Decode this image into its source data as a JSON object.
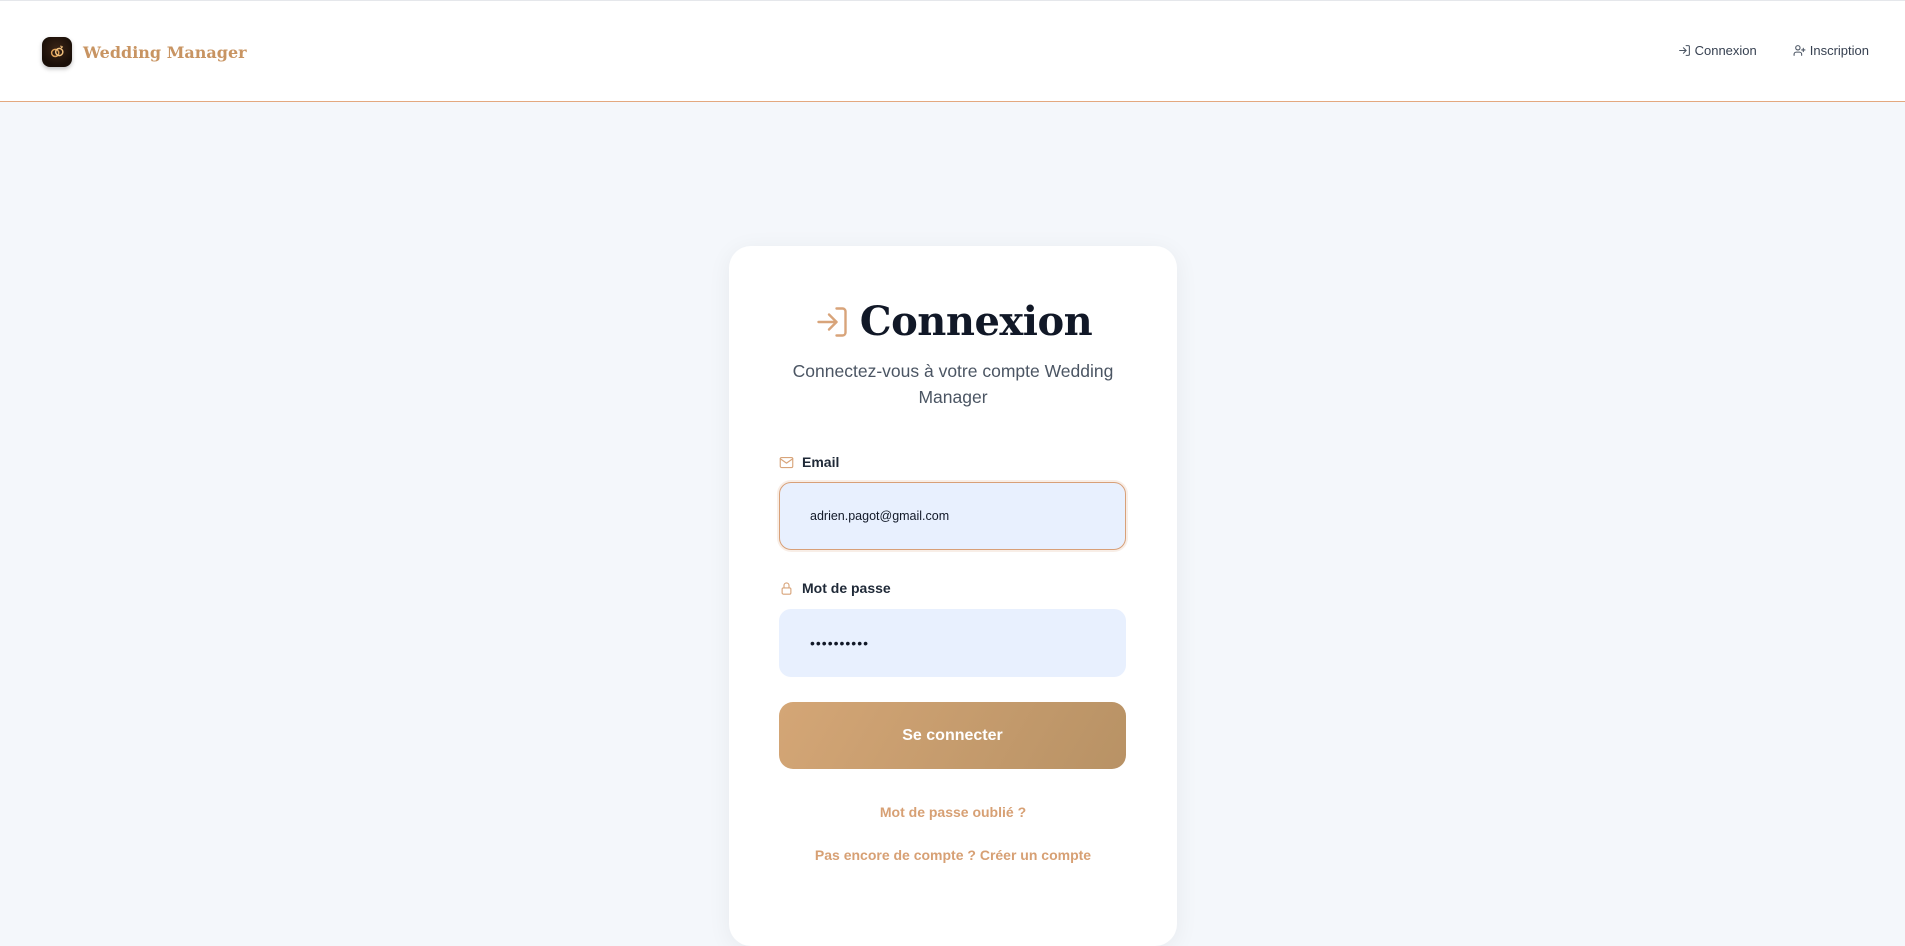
{
  "header": {
    "brand_name": "Wedding Manager",
    "nav": [
      {
        "label": "Connexion",
        "icon": "login-icon"
      },
      {
        "label": "Inscription",
        "icon": "user-plus-icon"
      }
    ]
  },
  "login": {
    "title": "Connexion",
    "title_icon": "login-icon",
    "subtitle": "Connectez-vous à votre compte Wedding Manager",
    "email": {
      "label": "Email",
      "icon": "mail-icon",
      "value": "adrien.pagot@gmail.com"
    },
    "password": {
      "label": "Mot de passe",
      "icon": "lock-icon",
      "value": "••••••••••"
    },
    "submit_label": "Se connecter",
    "forgot_link": "Mot de passe oublié ?",
    "register_link": "Pas encore de compte ? Créer un compte"
  },
  "colors": {
    "accent": "#d4a676",
    "accent_dark": "#b89265",
    "background": "#f4f7fb",
    "input_bg": "#e8f0fe",
    "link": "#d7a074"
  }
}
